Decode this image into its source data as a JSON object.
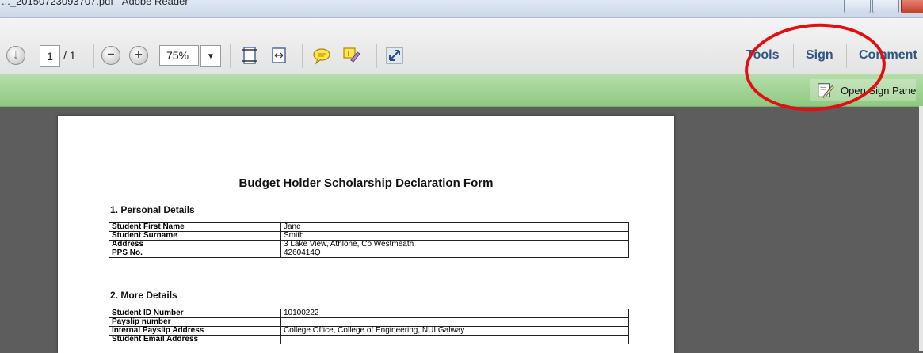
{
  "window": {
    "title": "..._20150723093707.pdf - Adobe Reader"
  },
  "toolbar": {
    "page_current": "1",
    "page_total": "/ 1",
    "zoom": "75%",
    "tabs": {
      "tools": "Tools",
      "sign": "Sign",
      "comment": "Comment"
    }
  },
  "sign_bar": {
    "open_sign_pane": "Open Sign Pane"
  },
  "document": {
    "title": "Budget Holder Scholarship Declaration Form",
    "section1": {
      "heading": "1. Personal Details",
      "rows": [
        {
          "label": "Student First Name",
          "value": "Jane"
        },
        {
          "label": "Student Surname",
          "value": "Smith"
        },
        {
          "label": "Address",
          "value": "3 Lake View, Athlone, Co Westmeath"
        },
        {
          "label": "PPS No.",
          "value": "4260414Q"
        }
      ]
    },
    "section2": {
      "heading": "2. More Details",
      "rows": [
        {
          "label": "Student ID Number",
          "value": "10100222"
        },
        {
          "label": "Payslip number",
          "value": ""
        },
        {
          "label": "Internal Payslip Address",
          "value": "College Office, College of Engineering, NUI Galway"
        },
        {
          "label": "Student Email Address",
          "value": ""
        }
      ]
    }
  },
  "colors": {
    "annotation": "#e10f12",
    "sign_bar": "#9fd493",
    "tab_text": "#2f5681"
  },
  "icons": [
    "back-arrow-icon",
    "zoom-out-icon",
    "zoom-in-icon",
    "fit-page-icon",
    "fit-width-icon",
    "sticky-note-icon",
    "highlight-icon",
    "fullscreen-icon",
    "sign-pane-icon"
  ]
}
